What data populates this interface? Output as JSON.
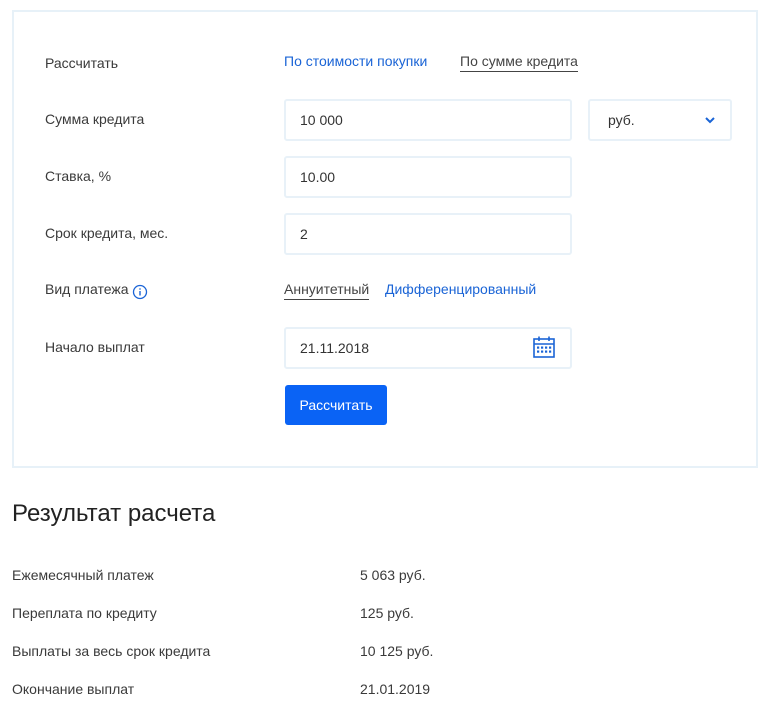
{
  "form": {
    "calc_by_label": "Рассчитать",
    "tab_by_price": "По стоимости покупки",
    "tab_by_amount": "По сумме кредита",
    "amount_label": "Сумма кредита",
    "amount_value": "10 000",
    "currency_value": "руб.",
    "rate_label": "Ставка, %",
    "rate_value": "10.00",
    "term_label": "Срок кредита, мес.",
    "term_value": "2",
    "payment_type_label": "Вид платежа",
    "payment_annuity": "Аннуитетный",
    "payment_diff": "Дифференцированный",
    "start_label": "Начало выплат",
    "start_value": "21.11.2018",
    "submit_label": "Рассчитать"
  },
  "result": {
    "title": "Результат расчета",
    "rows": [
      {
        "label": "Ежемесячный платеж",
        "value": "5 063 руб."
      },
      {
        "label": "Переплата по кредиту",
        "value": "125 руб."
      },
      {
        "label": "Выплаты за весь срок кредита",
        "value": "10 125 руб."
      },
      {
        "label": "Окончание выплат",
        "value": "21.01.2019"
      }
    ]
  },
  "colors": {
    "accent": "#0a63f5",
    "link": "#1a64d6",
    "border": "#e7f1f8"
  },
  "icons": {
    "info": "info-icon",
    "calendar": "calendar-icon",
    "chevron": "chevron-down-icon"
  }
}
